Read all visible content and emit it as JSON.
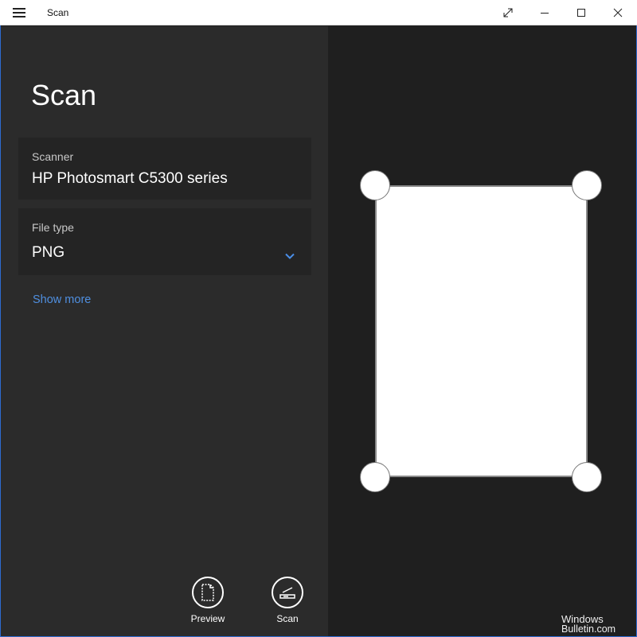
{
  "window": {
    "title": "Scan"
  },
  "page": {
    "title": "Scan"
  },
  "scanner": {
    "label": "Scanner",
    "value": "HP Photosmart C5300 series"
  },
  "file_type": {
    "label": "File type",
    "value": "PNG"
  },
  "links": {
    "show_more": "Show more"
  },
  "actions": {
    "preview_label": "Preview",
    "scan_label": "Scan"
  },
  "watermark": {
    "line1": "Windows",
    "line2": "Bulletin.com"
  },
  "colors": {
    "accent": "#4f8fe0",
    "panel": "#2b2b2b",
    "background": "#1f1f1f"
  },
  "icons": {
    "menu": "hamburger-icon",
    "expand": "expand-icon",
    "minimize": "minimize-icon",
    "maximize": "maximize-icon",
    "close": "close-icon",
    "dropdown": "chevron-down-icon",
    "preview": "preview-icon",
    "scan": "scanner-icon"
  }
}
